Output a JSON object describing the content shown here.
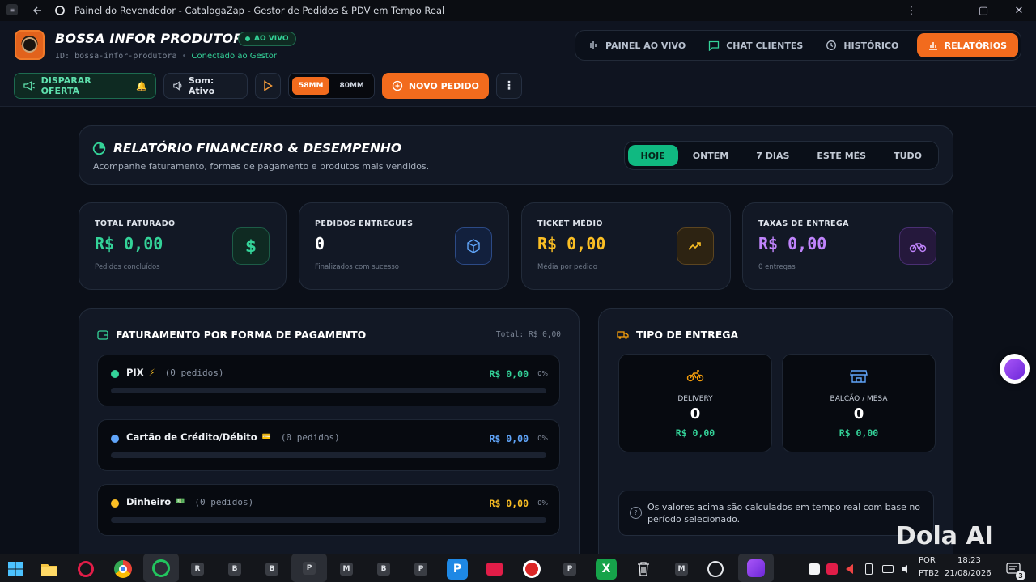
{
  "window": {
    "title": "Painel do Revendedor - CatalogaZap - Gestor de Pedidos & PDV em Tempo Real",
    "minimize": "–",
    "maximize": "▢",
    "close": "✕",
    "menu": "⋮"
  },
  "header": {
    "brand": "BOSSA INFOR PRODUTORA",
    "live_badge": "AO VIVO",
    "id_text": "ID: bossa-infor-produtora",
    "separator": "•",
    "connection": "Conectado ao Gestor",
    "nav": [
      {
        "label": "PAINEL AO VIVO",
        "icon": "live-panel-icon"
      },
      {
        "label": "CHAT CLIENTES",
        "icon": "chat-icon"
      },
      {
        "label": "HISTÓRICO",
        "icon": "history-icon"
      },
      {
        "label": "RELATÓRIOS",
        "icon": "bar-chart-icon",
        "active": true
      }
    ],
    "toolbar": {
      "fire_offer": "DISPARAR OFERTA",
      "sound": "Som: Ativo",
      "paper_58": "58MM",
      "paper_80": "80MM",
      "new_order": "NOVO PEDIDO"
    }
  },
  "report": {
    "title": "RELATÓRIO FINANCEIRO & DESEMPENHO",
    "subtitle": "Acompanhe faturamento, formas de pagamento e produtos mais vendidos.",
    "periods": [
      "HOJE",
      "ONTEM",
      "7 DIAS",
      "ESTE MÊS",
      "TUDO"
    ],
    "active_period": "HOJE"
  },
  "stats": [
    {
      "label": "TOTAL FATURADO",
      "value": "R$ 0,00",
      "note": "Pedidos concluídos",
      "color": "#34d399",
      "icon": "dollar-icon"
    },
    {
      "label": "PEDIDOS ENTREGUES",
      "value": "0",
      "note": "Finalizados com sucesso",
      "color": "#ffffff",
      "icon": "box-icon"
    },
    {
      "label": "TICKET MÉDIO",
      "value": "R$ 0,00",
      "note": "Média por pedido",
      "color": "#fbbf24",
      "icon": "trending-up-icon"
    },
    {
      "label": "TAXAS DE ENTREGA",
      "value": "R$ 0,00",
      "note": "0 entregas",
      "color": "#c084fc",
      "icon": "bike-icon"
    }
  ],
  "payments": {
    "title": "FATURAMENTO POR FORMA DE PAGAMENTO",
    "total": "Total: R$ 0,00",
    "rows": [
      {
        "name": "PIX",
        "emoji": "⚡",
        "count": "(0 pedidos)",
        "value": "R$ 0,00",
        "pct": "0%",
        "progress": 0,
        "color": "#34d399"
      },
      {
        "name": "Cartão de Crédito/Débito",
        "emoji": "💳",
        "count": "(0 pedidos)",
        "value": "R$ 0,00",
        "pct": "0%",
        "progress": 0,
        "color": "#60a5fa"
      },
      {
        "name": "Dinheiro",
        "emoji": "💵",
        "count": "(0 pedidos)",
        "value": "R$ 0,00",
        "pct": "0%",
        "progress": 0,
        "color": "#fbbf24"
      }
    ]
  },
  "delivery": {
    "title": "TIPO DE ENTREGA",
    "boxes": [
      {
        "label": "DELIVERY",
        "count": "0",
        "value": "R$ 0,00",
        "icon": "bike-icon"
      },
      {
        "label": "BALCÃO / MESA",
        "count": "0",
        "value": "R$ 0,00",
        "icon": "store-icon"
      }
    ],
    "info": "Os valores acima são calculados em tempo real com base no período selecionado."
  },
  "watermark": "Dola AI",
  "taskbar": {
    "apps": [
      "R",
      "B",
      "B",
      "P",
      "M",
      "B",
      "P",
      "P",
      "M"
    ],
    "lang_top": "POR",
    "lang_bottom": "PTB2",
    "time": "18:23",
    "date": "21/08/2026",
    "notif": "3"
  }
}
